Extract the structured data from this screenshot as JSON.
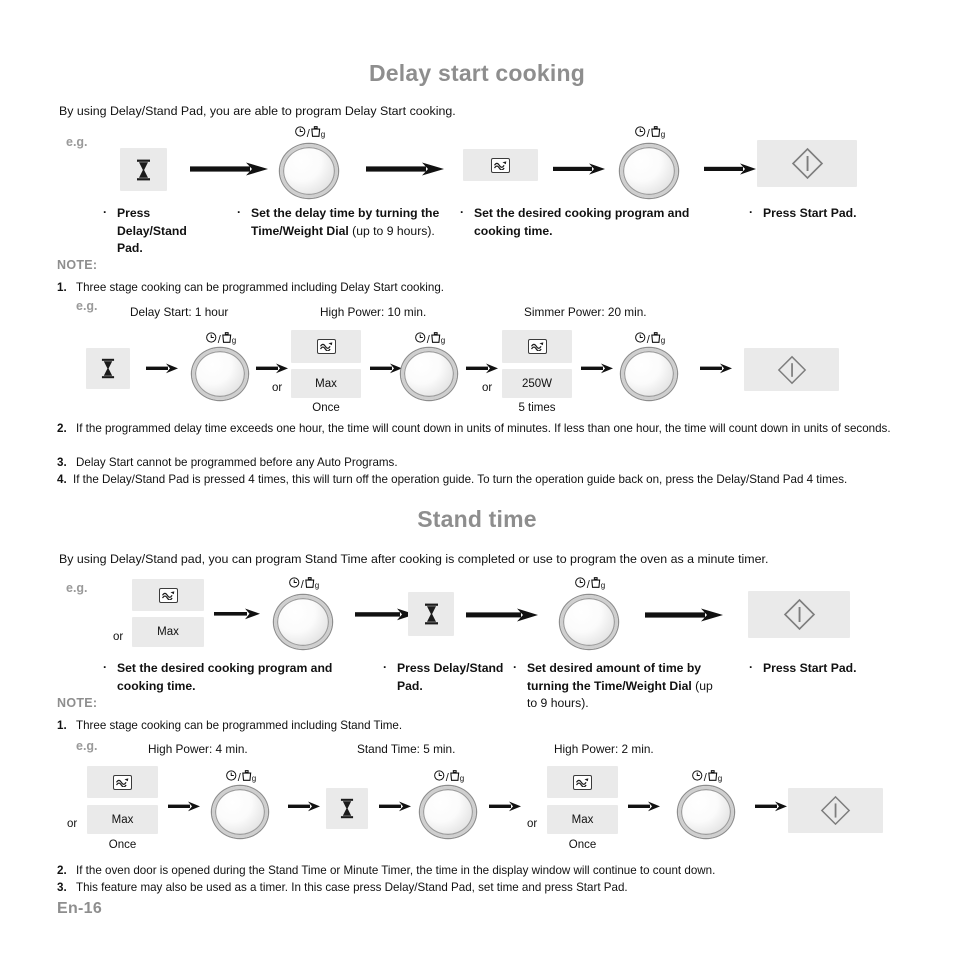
{
  "sections": [
    {
      "title": "Delay start cooking",
      "intro": "By using Delay/Stand Pad, you are able to program Delay Start cooking.",
      "eg_label": "e.g.",
      "note_label": "NOTE:",
      "steps": [
        {
          "bullet": "·",
          "bold": "Press Delay/Stand Pad.",
          "regular": ""
        },
        {
          "bullet": "·",
          "bold": "Set the delay time by turning the Time/Weight Dial ",
          "regular": "(up to 9 hours)."
        },
        {
          "bullet": "·",
          "bold": "Set the desired cooking program and cooking time.",
          "regular": ""
        },
        {
          "bullet": "·",
          "bold": "Press Start Pad.",
          "regular": ""
        }
      ],
      "notes": [
        {
          "num": "1.",
          "text": "Three stage cooking can be programmed including Delay Start cooking."
        },
        {
          "num": "2.",
          "text": "If the programmed delay time exceeds one hour, the time will count down in units of minutes. If less than one hour, the time will count down in units of seconds."
        },
        {
          "num": "3.",
          "text": "Delay Start cannot be programmed before any Auto Programs."
        },
        {
          "num": "4.",
          "text": "If the Delay/Stand Pad is pressed 4 times, this will turn off the operation guide. To turn the operation guide back on, press the Delay/Stand Pad 4 times."
        }
      ],
      "example_stages": [
        "Delay Start: 1 hour",
        "High Power: 10 min.",
        "Simmer Power: 20 min."
      ],
      "example_captions": {
        "or": "or",
        "max": "Max",
        "once": "Once",
        "power_250": "250W",
        "five_times": "5 times"
      }
    },
    {
      "title": "Stand time",
      "intro": "By using Delay/Stand pad, you can program Stand Time after cooking is completed or use to program the oven as a minute timer.",
      "eg_label": "e.g.",
      "note_label": "NOTE:",
      "steps": [
        {
          "bullet": "·",
          "bold": "Set the desired cooking program and cooking time.",
          "regular": ""
        },
        {
          "bullet": "·",
          "bold": "Press Delay/Stand Pad.",
          "regular": ""
        },
        {
          "bullet": "·",
          "bold": "Set desired amount of time by turning the Time/Weight Dial ",
          "regular": "(up to 9 hours)."
        },
        {
          "bullet": "·",
          "bold": "Press Start Pad.",
          "regular": ""
        }
      ],
      "notes": [
        {
          "num": "1.",
          "text": "Three stage cooking can be programmed including Stand Time."
        },
        {
          "num": "2.",
          "text": "If the oven door is opened during the Stand Time or Minute Timer, the time in the display window will continue to count down."
        },
        {
          "num": "3.",
          "text": "This feature may also be used as a timer. In this case press Delay/Stand Pad, set time and press Start Pad."
        }
      ],
      "example_stages": [
        "High Power: 4 min.",
        "Stand Time: 5 min.",
        "High Power: 2 min."
      ],
      "example_captions": {
        "or": "or",
        "max": "Max",
        "once": "Once"
      }
    }
  ],
  "dial": {
    "clock_icon": "clock-icon",
    "weight_icon": "weight-icon",
    "slash": "/",
    "unit": "g"
  },
  "icons": {
    "hourglass": "hourglass-icon",
    "microwave": "microwave-wave-icon",
    "start": "start-diamond-icon",
    "arrow": "arrow-right-icon"
  },
  "page_number": "En-16",
  "colors": {
    "heading": "#8e8e8e",
    "pad_bg": "#eaeaea",
    "text": "#111111"
  }
}
